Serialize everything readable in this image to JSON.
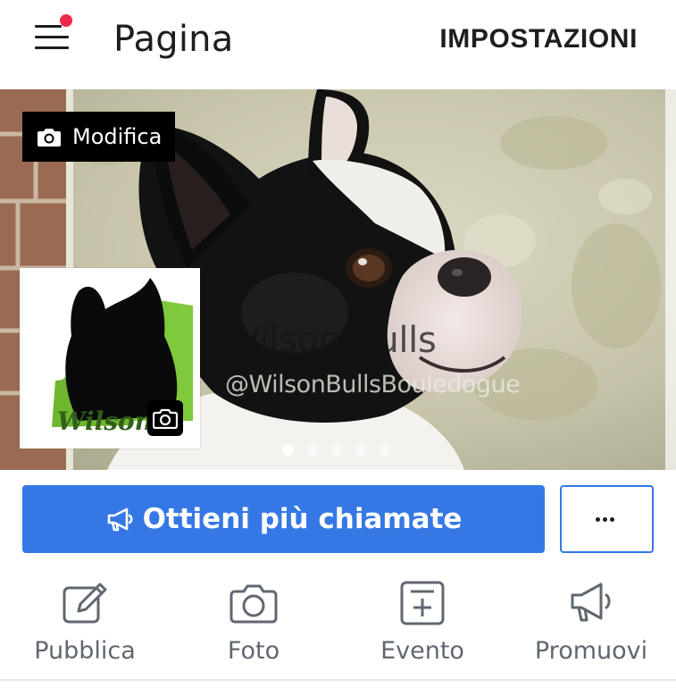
{
  "header": {
    "title": "Pagina",
    "settings_label": "IMPOSTAZIONI",
    "menu_icon": "hamburger-menu-icon",
    "notification_dot_color": "#f0284a"
  },
  "cover": {
    "edit_label": "Modifica",
    "edit_icon": "camera-icon",
    "page_name": "Wilson Bulls",
    "page_handle": "@WilsonBullsBouledogue",
    "carousel": {
      "total": 5,
      "active_index": 0
    },
    "profile_camera_icon": "camera-icon"
  },
  "actions": {
    "primary_label": "Ottieni più chiamate",
    "primary_icon": "megaphone-icon",
    "primary_color": "#3578e5",
    "more_icon": "more-dots-icon"
  },
  "shortcuts": [
    {
      "label": "Pubblica",
      "icon": "edit-post-icon"
    },
    {
      "label": "Foto",
      "icon": "camera-icon"
    },
    {
      "label": "Evento",
      "icon": "calendar-plus-icon"
    },
    {
      "label": "Promuovi",
      "icon": "megaphone-icon"
    }
  ]
}
